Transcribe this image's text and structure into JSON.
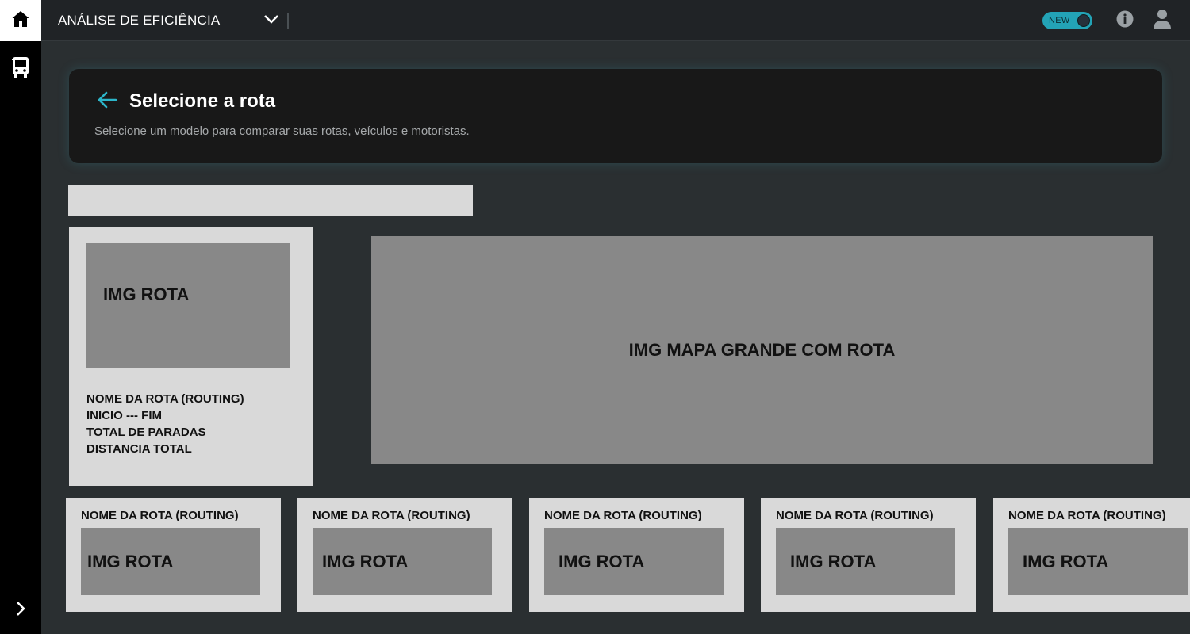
{
  "header": {
    "title": "ANÁLISE DE EFICIÊNCIA",
    "new_toggle_label": "NEW"
  },
  "page": {
    "title": "Selecione a rota",
    "subtitle": "Selecione um modelo para comparar suas rotas, veículos e motoristas."
  },
  "selected_route": {
    "image_label": "IMG ROTA",
    "name": "NOME DA ROTA (ROUTING)",
    "start_end": "INICIO --- FIM",
    "stops": "TOTAL DE PARADAS",
    "distance": "DISTANCIA TOTAL"
  },
  "map": {
    "label": "IMG MAPA GRANDE COM ROTA"
  },
  "route_cards": [
    {
      "name": "NOME DA ROTA (ROUTING)",
      "image_label": "IMG ROTA"
    },
    {
      "name": "NOME DA ROTA (ROUTING)",
      "image_label": "IMG ROTA"
    },
    {
      "name": "NOME DA ROTA (ROUTING)",
      "image_label": "IMG ROTA"
    },
    {
      "name": "NOME DA ROTA (ROUTING)",
      "image_label": "IMG ROTA"
    },
    {
      "name": "NOME DA ROTA (ROUTING)",
      "image_label": "IMG ROTA"
    }
  ],
  "icons": {
    "home": "home-icon",
    "bus": "bus-icon",
    "expand": "chevron-right-icon",
    "dropdown": "chevron-down-icon",
    "info": "info-icon",
    "user": "user-icon",
    "back": "arrow-left-icon"
  },
  "colors": {
    "accent": "#23a3b6",
    "background": "#2a2f31",
    "card_dark": "#181818",
    "placeholder_light": "#d9d9d9",
    "placeholder_image": "#888888"
  }
}
